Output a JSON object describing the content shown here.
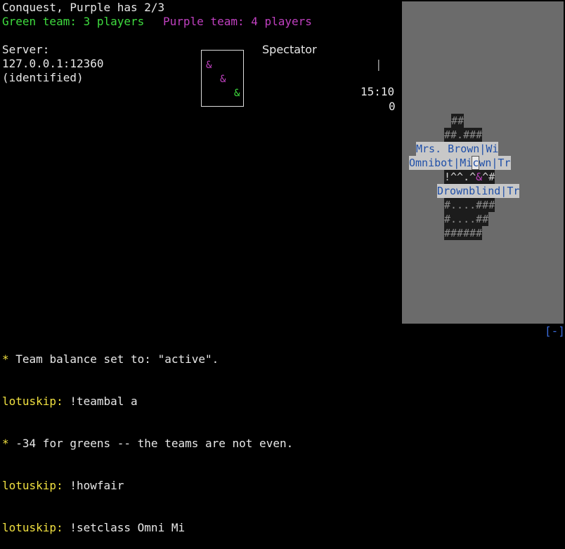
{
  "header": {
    "mode": "Conquest, Purple has 2/3",
    "green_team": "Green team: 3 players",
    "purple_team": "Purple team: 4 players"
  },
  "server": {
    "label": "Server:",
    "address": "127.0.0.1:12360",
    "status": "(identified)"
  },
  "minimap": {
    "symbols": [
      {
        "glyph": "&",
        "team": "purple"
      },
      {
        "glyph": "&",
        "team": "purple"
      },
      {
        "glyph": "&",
        "team": "green"
      }
    ]
  },
  "status": {
    "role": "Spectator",
    "cursor": "|",
    "timer": "15:10",
    "score": "0"
  },
  "viewport": {
    "rows": [
      {
        "text": "##",
        "style": "wall"
      },
      {
        "text": "##.###",
        "style": "wall"
      },
      {
        "text": "Mrs. Brown|Wi",
        "style": "name"
      },
      {
        "text": "Omnibot|Mi",
        "cursor_char": "c",
        "text2": "wn|Tr",
        "style": "name"
      },
      {
        "text": "!^^.^",
        "amp": "&",
        "text2": "^#",
        "style": "floor"
      },
      {
        "text": "Drownblind|Tr",
        "style": "name"
      },
      {
        "text": "#....###",
        "style": "wall"
      },
      {
        "text": "#....##",
        "style": "wall"
      },
      {
        "text": "######",
        "style": "wall"
      }
    ]
  },
  "log": {
    "toggle": "[-]",
    "lines": [
      {
        "prefix": "*",
        "text": " Team balance set to: \"active\"."
      },
      {
        "user": "lotuskip:",
        "text": " !teambal a"
      },
      {
        "prefix": "*",
        "text": " -34 for greens -- the teams are not even."
      },
      {
        "user": "lotuskip:",
        "text": " !howfair"
      },
      {
        "user": "lotuskip:",
        "text": " !setclass Omni Mi"
      }
    ]
  }
}
